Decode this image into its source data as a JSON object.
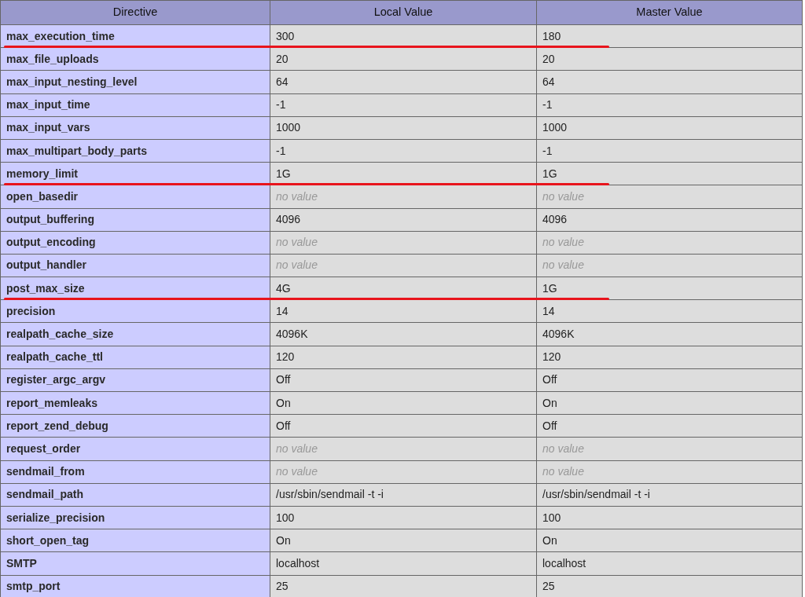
{
  "table": {
    "columns": [
      "Directive",
      "Local Value",
      "Master Value"
    ],
    "rows": [
      {
        "directive": "max_execution_time",
        "local": "300",
        "master": "180",
        "no_value": false,
        "underlined": true
      },
      {
        "directive": "max_file_uploads",
        "local": "20",
        "master": "20",
        "no_value": false,
        "underlined": false
      },
      {
        "directive": "max_input_nesting_level",
        "local": "64",
        "master": "64",
        "no_value": false,
        "underlined": false
      },
      {
        "directive": "max_input_time",
        "local": "-1",
        "master": "-1",
        "no_value": false,
        "underlined": false
      },
      {
        "directive": "max_input_vars",
        "local": "1000",
        "master": "1000",
        "no_value": false,
        "underlined": false
      },
      {
        "directive": "max_multipart_body_parts",
        "local": "-1",
        "master": "-1",
        "no_value": false,
        "underlined": false
      },
      {
        "directive": "memory_limit",
        "local": "1G",
        "master": "1G",
        "no_value": false,
        "underlined": true
      },
      {
        "directive": "open_basedir",
        "local": "no value",
        "master": "no value",
        "no_value": true,
        "underlined": false
      },
      {
        "directive": "output_buffering",
        "local": "4096",
        "master": "4096",
        "no_value": false,
        "underlined": false
      },
      {
        "directive": "output_encoding",
        "local": "no value",
        "master": "no value",
        "no_value": true,
        "underlined": false
      },
      {
        "directive": "output_handler",
        "local": "no value",
        "master": "no value",
        "no_value": true,
        "underlined": false
      },
      {
        "directive": "post_max_size",
        "local": "4G",
        "master": "1G",
        "no_value": false,
        "underlined": true
      },
      {
        "directive": "precision",
        "local": "14",
        "master": "14",
        "no_value": false,
        "underlined": false
      },
      {
        "directive": "realpath_cache_size",
        "local": "4096K",
        "master": "4096K",
        "no_value": false,
        "underlined": false
      },
      {
        "directive": "realpath_cache_ttl",
        "local": "120",
        "master": "120",
        "no_value": false,
        "underlined": false
      },
      {
        "directive": "register_argc_argv",
        "local": "Off",
        "master": "Off",
        "no_value": false,
        "underlined": false
      },
      {
        "directive": "report_memleaks",
        "local": "On",
        "master": "On",
        "no_value": false,
        "underlined": false
      },
      {
        "directive": "report_zend_debug",
        "local": "Off",
        "master": "Off",
        "no_value": false,
        "underlined": false
      },
      {
        "directive": "request_order",
        "local": "no value",
        "master": "no value",
        "no_value": true,
        "underlined": false
      },
      {
        "directive": "sendmail_from",
        "local": "no value",
        "master": "no value",
        "no_value": true,
        "underlined": false
      },
      {
        "directive": "sendmail_path",
        "local": "/usr/sbin/sendmail -t -i",
        "master": "/usr/sbin/sendmail -t -i",
        "no_value": false,
        "underlined": false
      },
      {
        "directive": "serialize_precision",
        "local": "100",
        "master": "100",
        "no_value": false,
        "underlined": false
      },
      {
        "directive": "short_open_tag",
        "local": "On",
        "master": "On",
        "no_value": false,
        "underlined": false
      },
      {
        "directive": "SMTP",
        "local": "localhost",
        "master": "localhost",
        "no_value": false,
        "underlined": false
      },
      {
        "directive": "smtp_port",
        "local": "25",
        "master": "25",
        "no_value": false,
        "underlined": false
      }
    ]
  }
}
